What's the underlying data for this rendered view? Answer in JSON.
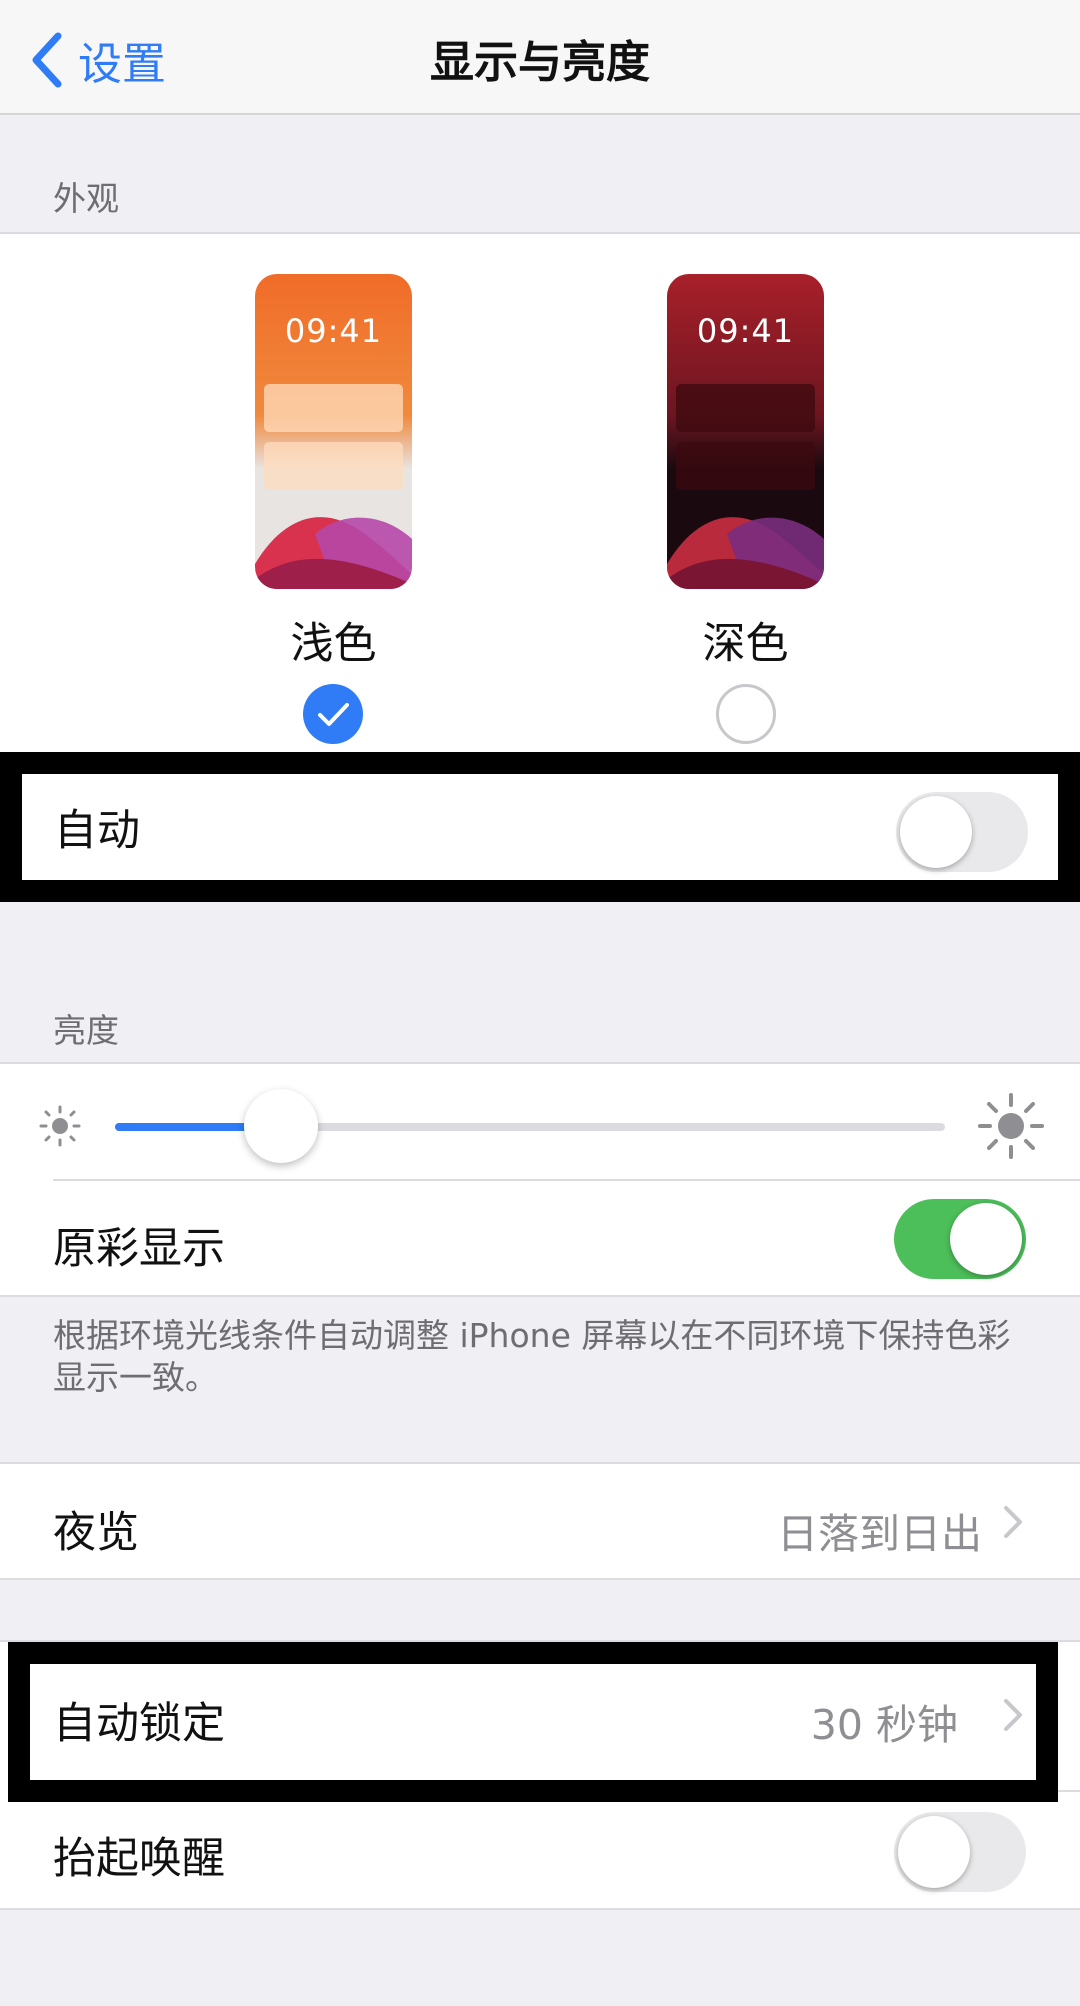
{
  "nav": {
    "back_label": "设置",
    "title": "显示与亮度"
  },
  "appearance": {
    "header": "外观",
    "light": {
      "time": "09:41",
      "label": "浅色",
      "selected": true
    },
    "dark": {
      "time": "09:41",
      "label": "深色",
      "selected": false
    },
    "auto": {
      "label": "自动",
      "on": false
    }
  },
  "brightness": {
    "header": "亮度",
    "level": 0.2,
    "true_tone": {
      "label": "原彩显示",
      "on": true
    },
    "footer": "根据环境光线条件自动调整 iPhone 屏幕以在不同环境下保持色彩显示一致。"
  },
  "night_shift": {
    "label": "夜览",
    "value": "日落到日出"
  },
  "auto_lock": {
    "label": "自动锁定",
    "value": "30 秒钟"
  },
  "raise_to_wake": {
    "label": "抬起唤醒",
    "on": false
  },
  "colors": {
    "accent": "#2f7cf6",
    "toggle_on": "#4cbe5a",
    "toggle_off": "#e9e9eb"
  }
}
